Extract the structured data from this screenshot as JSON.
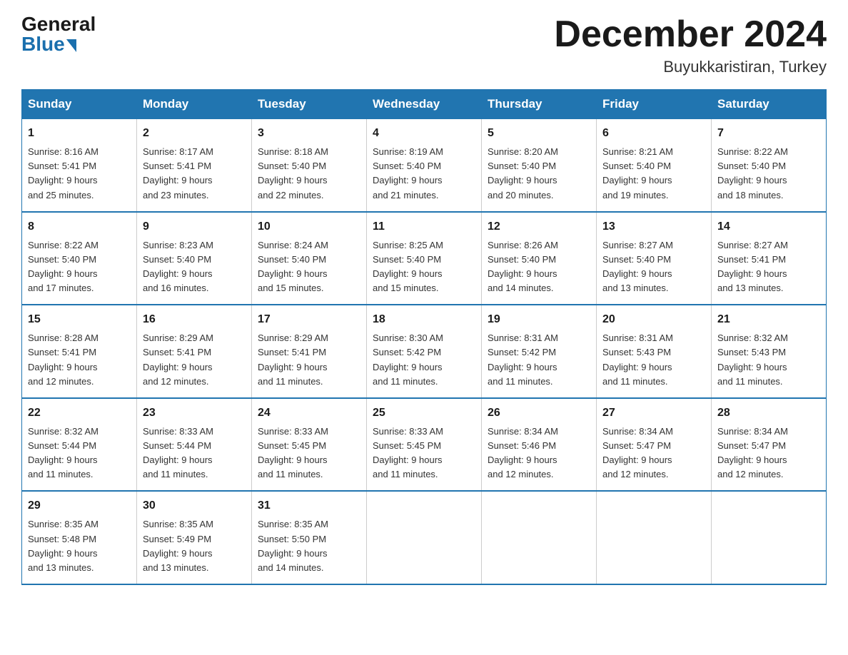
{
  "logo": {
    "general": "General",
    "blue": "Blue"
  },
  "title": "December 2024",
  "subtitle": "Buyukkaristiran, Turkey",
  "days_header": [
    "Sunday",
    "Monday",
    "Tuesday",
    "Wednesday",
    "Thursday",
    "Friday",
    "Saturday"
  ],
  "weeks": [
    [
      {
        "day": "1",
        "sunrise": "8:16 AM",
        "sunset": "5:41 PM",
        "daylight": "9 hours and 25 minutes."
      },
      {
        "day": "2",
        "sunrise": "8:17 AM",
        "sunset": "5:41 PM",
        "daylight": "9 hours and 23 minutes."
      },
      {
        "day": "3",
        "sunrise": "8:18 AM",
        "sunset": "5:40 PM",
        "daylight": "9 hours and 22 minutes."
      },
      {
        "day": "4",
        "sunrise": "8:19 AM",
        "sunset": "5:40 PM",
        "daylight": "9 hours and 21 minutes."
      },
      {
        "day": "5",
        "sunrise": "8:20 AM",
        "sunset": "5:40 PM",
        "daylight": "9 hours and 20 minutes."
      },
      {
        "day": "6",
        "sunrise": "8:21 AM",
        "sunset": "5:40 PM",
        "daylight": "9 hours and 19 minutes."
      },
      {
        "day": "7",
        "sunrise": "8:22 AM",
        "sunset": "5:40 PM",
        "daylight": "9 hours and 18 minutes."
      }
    ],
    [
      {
        "day": "8",
        "sunrise": "8:22 AM",
        "sunset": "5:40 PM",
        "daylight": "9 hours and 17 minutes."
      },
      {
        "day": "9",
        "sunrise": "8:23 AM",
        "sunset": "5:40 PM",
        "daylight": "9 hours and 16 minutes."
      },
      {
        "day": "10",
        "sunrise": "8:24 AM",
        "sunset": "5:40 PM",
        "daylight": "9 hours and 15 minutes."
      },
      {
        "day": "11",
        "sunrise": "8:25 AM",
        "sunset": "5:40 PM",
        "daylight": "9 hours and 15 minutes."
      },
      {
        "day": "12",
        "sunrise": "8:26 AM",
        "sunset": "5:40 PM",
        "daylight": "9 hours and 14 minutes."
      },
      {
        "day": "13",
        "sunrise": "8:27 AM",
        "sunset": "5:40 PM",
        "daylight": "9 hours and 13 minutes."
      },
      {
        "day": "14",
        "sunrise": "8:27 AM",
        "sunset": "5:41 PM",
        "daylight": "9 hours and 13 minutes."
      }
    ],
    [
      {
        "day": "15",
        "sunrise": "8:28 AM",
        "sunset": "5:41 PM",
        "daylight": "9 hours and 12 minutes."
      },
      {
        "day": "16",
        "sunrise": "8:29 AM",
        "sunset": "5:41 PM",
        "daylight": "9 hours and 12 minutes."
      },
      {
        "day": "17",
        "sunrise": "8:29 AM",
        "sunset": "5:41 PM",
        "daylight": "9 hours and 11 minutes."
      },
      {
        "day": "18",
        "sunrise": "8:30 AM",
        "sunset": "5:42 PM",
        "daylight": "9 hours and 11 minutes."
      },
      {
        "day": "19",
        "sunrise": "8:31 AM",
        "sunset": "5:42 PM",
        "daylight": "9 hours and 11 minutes."
      },
      {
        "day": "20",
        "sunrise": "8:31 AM",
        "sunset": "5:43 PM",
        "daylight": "9 hours and 11 minutes."
      },
      {
        "day": "21",
        "sunrise": "8:32 AM",
        "sunset": "5:43 PM",
        "daylight": "9 hours and 11 minutes."
      }
    ],
    [
      {
        "day": "22",
        "sunrise": "8:32 AM",
        "sunset": "5:44 PM",
        "daylight": "9 hours and 11 minutes."
      },
      {
        "day": "23",
        "sunrise": "8:33 AM",
        "sunset": "5:44 PM",
        "daylight": "9 hours and 11 minutes."
      },
      {
        "day": "24",
        "sunrise": "8:33 AM",
        "sunset": "5:45 PM",
        "daylight": "9 hours and 11 minutes."
      },
      {
        "day": "25",
        "sunrise": "8:33 AM",
        "sunset": "5:45 PM",
        "daylight": "9 hours and 11 minutes."
      },
      {
        "day": "26",
        "sunrise": "8:34 AM",
        "sunset": "5:46 PM",
        "daylight": "9 hours and 12 minutes."
      },
      {
        "day": "27",
        "sunrise": "8:34 AM",
        "sunset": "5:47 PM",
        "daylight": "9 hours and 12 minutes."
      },
      {
        "day": "28",
        "sunrise": "8:34 AM",
        "sunset": "5:47 PM",
        "daylight": "9 hours and 12 minutes."
      }
    ],
    [
      {
        "day": "29",
        "sunrise": "8:35 AM",
        "sunset": "5:48 PM",
        "daylight": "9 hours and 13 minutes."
      },
      {
        "day": "30",
        "sunrise": "8:35 AM",
        "sunset": "5:49 PM",
        "daylight": "9 hours and 13 minutes."
      },
      {
        "day": "31",
        "sunrise": "8:35 AM",
        "sunset": "5:50 PM",
        "daylight": "9 hours and 14 minutes."
      },
      null,
      null,
      null,
      null
    ]
  ],
  "labels": {
    "sunrise": "Sunrise:",
    "sunset": "Sunset:",
    "daylight": "Daylight:"
  }
}
